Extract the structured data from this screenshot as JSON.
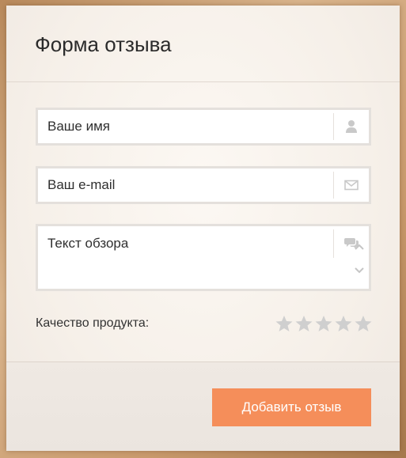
{
  "form": {
    "title": "Форма отзыва",
    "name_placeholder": "Ваше имя",
    "email_placeholder": "Ваш e-mail",
    "review_placeholder": "Текст обзора",
    "quality_label": "Качество продукта:",
    "rating": {
      "value": 0,
      "max": 5
    },
    "submit_label": "Добавить отзыв",
    "icons": {
      "name": "user-icon",
      "email": "envelope-icon",
      "review": "comment-icon",
      "star": "star-icon"
    },
    "colors": {
      "accent": "#f58e5a",
      "star": "#cfcfcf",
      "icon": "#c9c9c9"
    }
  }
}
